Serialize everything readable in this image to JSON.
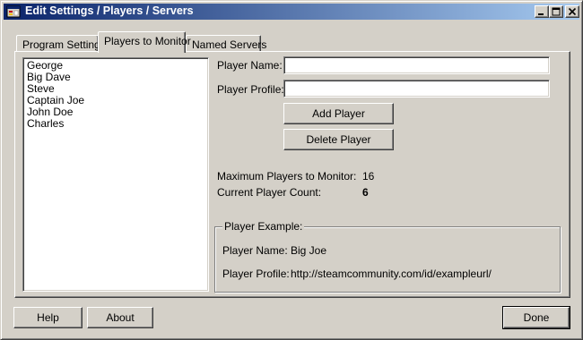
{
  "window": {
    "title": "Edit Settings / Players / Servers"
  },
  "tabs": [
    {
      "label": "Program Settings",
      "active": false
    },
    {
      "label": "Players to Monitor",
      "active": true
    },
    {
      "label": "Named Servers",
      "active": false
    }
  ],
  "players": [
    "George",
    "Big Dave",
    "Steve",
    "Captain Joe",
    "John Doe",
    "Charles"
  ],
  "form": {
    "player_name_label": "Player Name:",
    "player_name_value": "",
    "player_profile_label": "Player Profile:",
    "player_profile_value": "",
    "add_button": "Add Player",
    "delete_button": "Delete Player"
  },
  "stats": {
    "max_label": "Maximum Players to Monitor:",
    "max_value": "16",
    "count_label": "Current Player Count:",
    "count_value": "6"
  },
  "example": {
    "legend": "Player Example:",
    "name_label": "Player Name:",
    "name_value": "Big Joe",
    "profile_label": "Player Profile:",
    "profile_value": "http://steamcommunity.com/id/exampleurl/"
  },
  "footer": {
    "help_button": "Help",
    "about_button": "About",
    "done_button": "Done"
  },
  "icons": {
    "app": "settings-window-icon",
    "minimize": "minimize-icon",
    "maximize": "maximize-icon",
    "close": "close-icon"
  }
}
